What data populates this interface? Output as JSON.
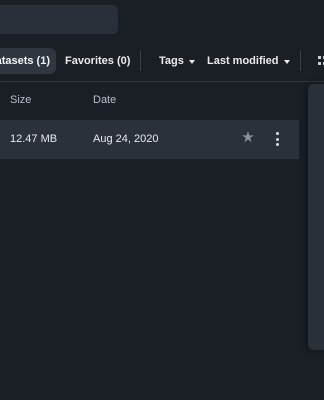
{
  "filters": {
    "datasets_label": "atasets (1)",
    "favorites_label": "Favorites (0)",
    "tags_label": "Tags",
    "sort_label": "Last modified"
  },
  "table": {
    "columns": {
      "size": "Size",
      "date": "Date"
    },
    "rows": [
      {
        "size": "12.47 MB",
        "date": "Aug 24, 2020",
        "favorite_icon": "star-icon",
        "menu_icon": "kebab-menu-icon"
      }
    ]
  },
  "view_icon": "grid-view-icon"
}
